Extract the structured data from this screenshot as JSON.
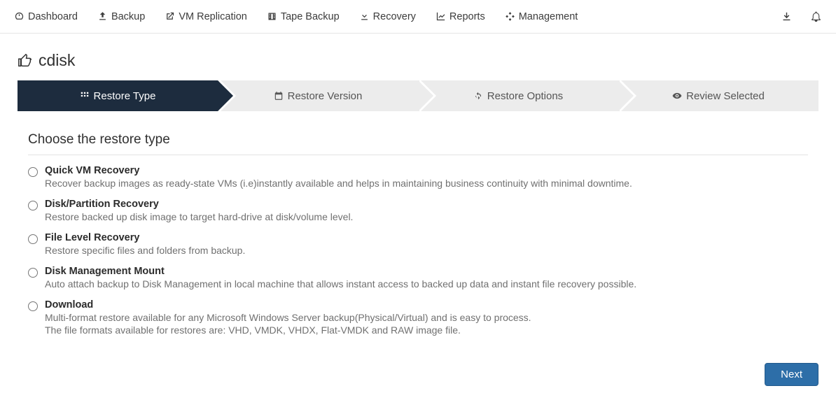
{
  "nav": {
    "dashboard": "Dashboard",
    "backup": "Backup",
    "vm_replication": "VM Replication",
    "tape_backup": "Tape Backup",
    "recovery": "Recovery",
    "reports": "Reports",
    "management": "Management"
  },
  "page_title": "cdisk",
  "wizard": {
    "step1": "Restore Type",
    "step2": "Restore Version",
    "step3": "Restore Options",
    "step4": "Review Selected"
  },
  "section_title": "Choose the restore type",
  "options": {
    "quick_vm": {
      "title": "Quick VM Recovery",
      "desc": "Recover backup images as ready-state VMs (i.e)instantly available and helps in maintaining business continuity with minimal downtime."
    },
    "disk_partition": {
      "title": "Disk/Partition Recovery",
      "desc": "Restore backed up disk image to target hard-drive at disk/volume level."
    },
    "file_level": {
      "title": "File Level Recovery",
      "desc": "Restore specific files and folders from backup."
    },
    "disk_mgmt": {
      "title": "Disk Management Mount",
      "desc": "Auto attach backup to Disk Management in local machine that allows instant access to backed up data and instant file recovery possible."
    },
    "download": {
      "title": "Download",
      "desc1": "Multi-format restore available for any Microsoft Windows Server backup(Physical/Virtual) and is easy to process.",
      "desc2": "The file formats available for restores are: VHD, VMDK, VHDX, Flat-VMDK and RAW image file."
    }
  },
  "buttons": {
    "next": "Next"
  }
}
